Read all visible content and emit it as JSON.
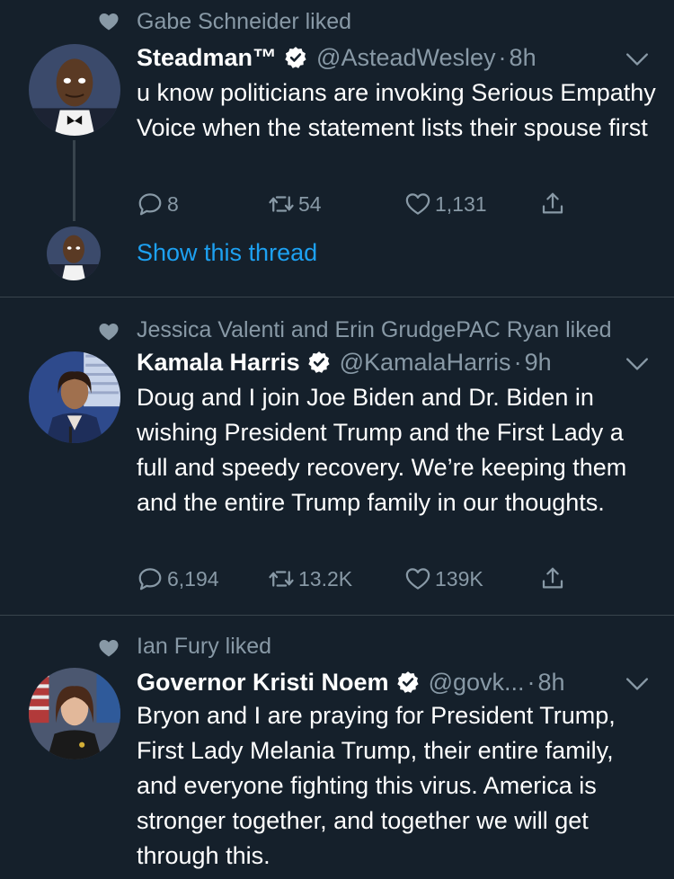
{
  "tweets": [
    {
      "liked_by": "Gabe Schneider liked",
      "name": "Steadman™",
      "handle": "@AsteadWesley",
      "time": "8h",
      "text": "u know politicians are invoking Serious Empathy Voice when the statement lists their spouse first",
      "replies": "8",
      "retweets": "54",
      "likes": "1,131",
      "show_thread": "Show this thread"
    },
    {
      "liked_by": "Jessica Valenti and Erin GrudgePAC Ryan liked",
      "name": "Kamala Harris",
      "handle": "@KamalaHarris",
      "time": "9h",
      "text": "Doug and I join Joe Biden and Dr. Biden in wishing President Trump and the First Lady a full and speedy recovery. We’re keeping them and the entire Trump family in our thoughts.",
      "replies": "6,194",
      "retweets": "13.2K",
      "likes": "139K"
    },
    {
      "liked_by": "Ian Fury liked",
      "name": "Governor Kristi Noem",
      "handle": "@govk...",
      "time": "8h",
      "text": "Bryon and I are praying for President Trump, First Lady Melania Trump, their entire family, and everyone fighting this virus. America is stronger together, and together we will get through this."
    }
  ],
  "colors": {
    "background": "#15202b",
    "secondary_text": "#8899a6",
    "link": "#1da1f2",
    "divider": "#38444d"
  },
  "icons": [
    "heart-icon",
    "verified-badge-icon",
    "chevron-down-icon",
    "reply-icon",
    "retweet-icon",
    "like-icon",
    "share-icon"
  ]
}
